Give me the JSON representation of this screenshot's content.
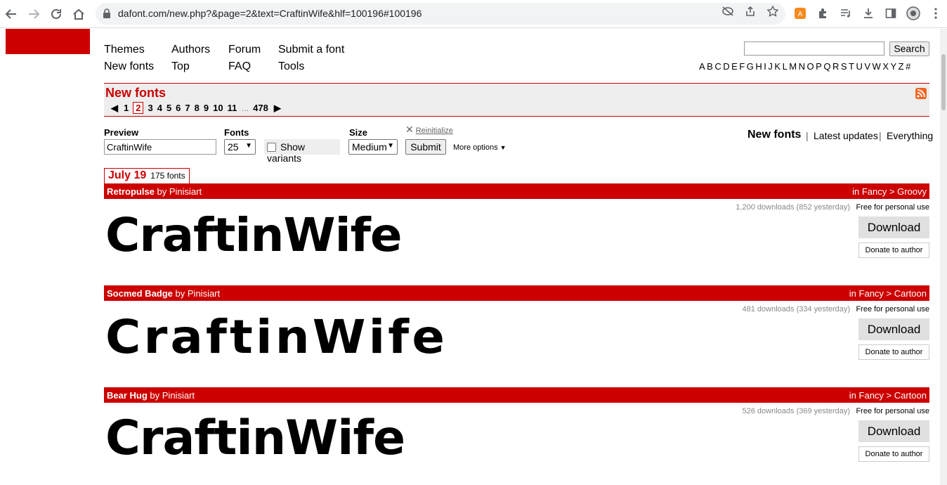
{
  "browser": {
    "url": "dafont.com/new.php?&page=2&text=CraftinWife&hlf=100196#100196"
  },
  "nav": {
    "themes": "Themes",
    "authors": "Authors",
    "forum": "Forum",
    "submit_font": "Submit a font",
    "new_fonts": "New fonts",
    "top": "Top",
    "faq": "FAQ",
    "tools": "Tools"
  },
  "search": {
    "value": "",
    "button": "Search"
  },
  "alphabet": [
    "A",
    "B",
    "C",
    "D",
    "E",
    "F",
    "G",
    "H",
    "I",
    "J",
    "K",
    "L",
    "M",
    "N",
    "O",
    "P",
    "Q",
    "R",
    "S",
    "T",
    "U",
    "V",
    "W",
    "X",
    "Y",
    "Z",
    "#"
  ],
  "section": {
    "title": "New fonts",
    "pages": [
      "1",
      "2",
      "3",
      "4",
      "5",
      "6",
      "7",
      "8",
      "9",
      "10",
      "11"
    ],
    "current_page": "2",
    "ellipsis": "...",
    "last_page": "478"
  },
  "form": {
    "preview_label": "Preview",
    "preview_value": "CraftinWife",
    "fonts_label": "Fonts",
    "fonts_value": "25",
    "variants_label": "Show variants",
    "size_label": "Size",
    "size_value": "Medium",
    "submit": "Submit",
    "reinitialize": "Reinitialize",
    "more_options": "More options"
  },
  "sort": {
    "new_fonts": "New fonts",
    "latest_updates": "Latest updates",
    "everything": "Everything",
    "sep": "|"
  },
  "date_group": {
    "date": "July 19",
    "count": "175 fonts"
  },
  "fonts": [
    {
      "name": "Retropulse",
      "by": "by Pinisiart",
      "category": "in Fancy > Groovy",
      "downloads": "1,200 downloads (852 yesterday)",
      "license": "Free for personal use",
      "preview": "CraftinWife",
      "download": "Download",
      "donate": "Donate to author"
    },
    {
      "name": "Socmed Badge",
      "by": "by Pinisiart",
      "category": "in Fancy > Cartoon",
      "downloads": "481 downloads (334 yesterday)",
      "license": "Free for personal use",
      "preview": "CraftinWife",
      "download": "Download",
      "donate": "Donate to author"
    },
    {
      "name": "Bear Hug",
      "by": "by Pinisiart",
      "category": "in Fancy > Cartoon",
      "downloads": "526 downloads (369 yesterday)",
      "license": "Free for personal use",
      "preview": "CraftinWife",
      "download": "Download",
      "donate": "Donate to author"
    }
  ],
  "colors": {
    "brand_red": "#cc0000",
    "bar_grey": "#eeeeee"
  }
}
